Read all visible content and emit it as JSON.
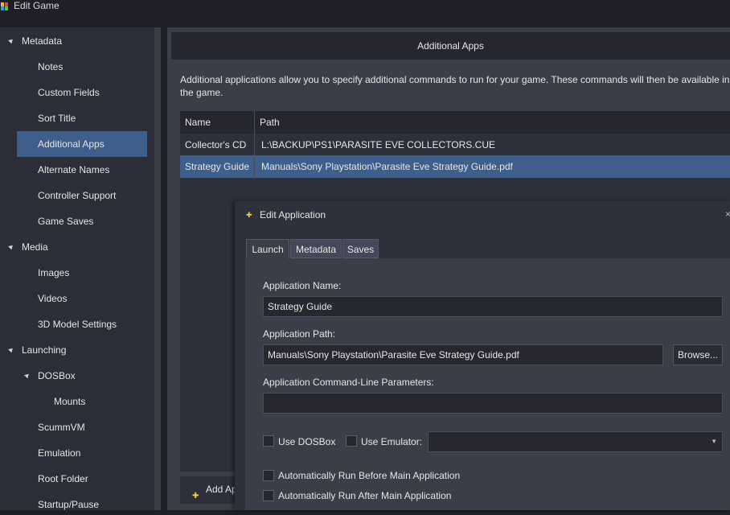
{
  "window": {
    "title": "Edit Game"
  },
  "tree": {
    "items": [
      {
        "label": "Metadata",
        "expander": true
      },
      {
        "label": "Notes"
      },
      {
        "label": "Custom Fields"
      },
      {
        "label": "Sort Title"
      },
      {
        "label": "Additional Apps",
        "selected": true
      },
      {
        "label": "Alternate Names"
      },
      {
        "label": "Controller Support"
      },
      {
        "label": "Game Saves"
      },
      {
        "label": "Media",
        "expander": true
      },
      {
        "label": "Images"
      },
      {
        "label": "Videos"
      },
      {
        "label": "3D Model Settings"
      },
      {
        "label": "Launching",
        "expander": true
      },
      {
        "label": "DOSBox",
        "expander": true
      },
      {
        "label": "Mounts"
      },
      {
        "label": "ScummVM"
      },
      {
        "label": "Emulation"
      },
      {
        "label": "Root Folder"
      },
      {
        "label": "Startup/Pause"
      }
    ]
  },
  "additional_apps": {
    "header": "Additional Apps",
    "description": "Additional applications allow you to specify additional commands to run for your game.  These commands will then be available in the game.",
    "columns": [
      "Name",
      "Path"
    ],
    "rows": [
      {
        "name": "Collector's CD",
        "path": "L:\\BACKUP\\PS1\\PARASITE EVE COLLECTORS.CUE"
      },
      {
        "name": "Strategy Guide",
        "path": "Manuals\\Sony Playstation\\Parasite Eve Strategy Guide.pdf",
        "selected": true
      }
    ],
    "add_button": "Add Ap"
  },
  "dialog": {
    "title": "Edit Application",
    "close": "×",
    "tabs": [
      "Launch",
      "Metadata",
      "Saves"
    ],
    "active_tab": "Launch",
    "app_name_label": "Application Name:",
    "app_name_value": "Strategy Guide",
    "app_path_label": "Application Path:",
    "app_path_value": "Manuals\\Sony Playstation\\Parasite Eve Strategy Guide.pdf",
    "browse_button": "Browse...",
    "cmdline_label": "Application Command-Line Parameters:",
    "cmdline_value": "",
    "use_dosbox_label": "Use DOSBox",
    "use_emulator_label": "Use Emulator:",
    "emulator_value": "",
    "auto_before_label": "Automatically Run Before Main Application",
    "auto_after_label": "Automatically Run After Main Application"
  },
  "colors": {
    "accent": "#3e5e8c",
    "background": "#1f2027",
    "panel": "#2b2d38"
  }
}
